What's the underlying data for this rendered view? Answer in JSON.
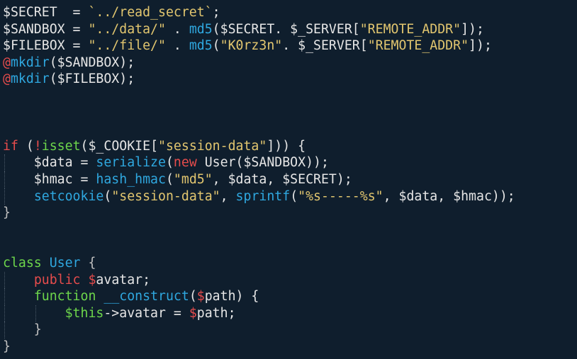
{
  "palette": {
    "background": "#0f1e2d",
    "default": "#e6e6e6",
    "variable": "#e6e6e6",
    "string": "#e2c66f",
    "function": "#2fa8e0",
    "keyword": "#e64c4c",
    "class": "#6dd64b",
    "this": "#6dd64b",
    "brace": "#bfbfbf"
  },
  "lines": [
    {
      "indent": 0,
      "tokens": [
        {
          "t": "$SECRET  = ",
          "c": "variable"
        },
        {
          "t": "`../read_secret`",
          "c": "string"
        },
        {
          "t": ";",
          "c": "default"
        }
      ]
    },
    {
      "indent": 0,
      "tokens": [
        {
          "t": "$SANDBOX = ",
          "c": "variable"
        },
        {
          "t": "\"../data/\"",
          "c": "string"
        },
        {
          "t": " . ",
          "c": "default"
        },
        {
          "t": "md5",
          "c": "function"
        },
        {
          "t": "($SECRET. $_SERVER[",
          "c": "default"
        },
        {
          "t": "\"REMOTE_ADDR\"",
          "c": "string"
        },
        {
          "t": "]);",
          "c": "default"
        }
      ]
    },
    {
      "indent": 0,
      "tokens": [
        {
          "t": "$FILEBOX = ",
          "c": "variable"
        },
        {
          "t": "\"../file/\"",
          "c": "string"
        },
        {
          "t": " . ",
          "c": "default"
        },
        {
          "t": "md5",
          "c": "function"
        },
        {
          "t": "(",
          "c": "default"
        },
        {
          "t": "\"K0rz3n\"",
          "c": "string"
        },
        {
          "t": ". $_SERVER[",
          "c": "default"
        },
        {
          "t": "\"REMOTE_ADDR\"",
          "c": "string"
        },
        {
          "t": "]);",
          "c": "default"
        }
      ]
    },
    {
      "indent": 0,
      "tokens": [
        {
          "t": "@",
          "c": "keyword"
        },
        {
          "t": "mkdir",
          "c": "function"
        },
        {
          "t": "($SANDBOX);",
          "c": "default"
        }
      ]
    },
    {
      "indent": 0,
      "tokens": [
        {
          "t": "@",
          "c": "keyword"
        },
        {
          "t": "mkdir",
          "c": "function"
        },
        {
          "t": "($FILEBOX);",
          "c": "default"
        }
      ]
    },
    {
      "indent": 0,
      "tokens": []
    },
    {
      "indent": 0,
      "tokens": []
    },
    {
      "indent": 0,
      "tokens": []
    },
    {
      "indent": 0,
      "tokens": [
        {
          "t": "if",
          "c": "keyword"
        },
        {
          "t": " (",
          "c": "default"
        },
        {
          "t": "!",
          "c": "keyword"
        },
        {
          "t": "isset",
          "c": "class"
        },
        {
          "t": "($_COOKIE[",
          "c": "default"
        },
        {
          "t": "\"session-data\"",
          "c": "string"
        },
        {
          "t": "])) {",
          "c": "default"
        }
      ]
    },
    {
      "indent": 1,
      "tokens": [
        {
          "t": "    $data = ",
          "c": "default"
        },
        {
          "t": "serialize",
          "c": "function"
        },
        {
          "t": "(",
          "c": "default"
        },
        {
          "t": "new",
          "c": "keyword"
        },
        {
          "t": " User($SANDBOX));",
          "c": "default"
        }
      ]
    },
    {
      "indent": 1,
      "tokens": [
        {
          "t": "    $hmac = ",
          "c": "default"
        },
        {
          "t": "hash_hmac",
          "c": "function"
        },
        {
          "t": "(",
          "c": "default"
        },
        {
          "t": "\"md5\"",
          "c": "string"
        },
        {
          "t": ", $data, $SECRET);",
          "c": "default"
        }
      ]
    },
    {
      "indent": 1,
      "tokens": [
        {
          "t": "    ",
          "c": "default"
        },
        {
          "t": "setcookie",
          "c": "function"
        },
        {
          "t": "(",
          "c": "default"
        },
        {
          "t": "\"session-data\"",
          "c": "string"
        },
        {
          "t": ", ",
          "c": "default"
        },
        {
          "t": "sprintf",
          "c": "function"
        },
        {
          "t": "(",
          "c": "default"
        },
        {
          "t": "\"%s-----%s\"",
          "c": "string"
        },
        {
          "t": ", $data, $hmac));",
          "c": "default"
        }
      ]
    },
    {
      "indent": 0,
      "tokens": [
        {
          "t": "}",
          "c": "brace"
        }
      ]
    },
    {
      "indent": 0,
      "tokens": []
    },
    {
      "indent": 0,
      "tokens": []
    },
    {
      "indent": 0,
      "tokens": [
        {
          "t": "class",
          "c": "class"
        },
        {
          "t": " ",
          "c": "default"
        },
        {
          "t": "User",
          "c": "function"
        },
        {
          "t": " {",
          "c": "brace"
        }
      ]
    },
    {
      "indent": 1,
      "tokens": [
        {
          "t": "    ",
          "c": "default"
        },
        {
          "t": "public",
          "c": "keyword"
        },
        {
          "t": " ",
          "c": "default"
        },
        {
          "t": "$",
          "c": "keyword"
        },
        {
          "t": "avatar;",
          "c": "default"
        }
      ]
    },
    {
      "indent": 1,
      "tokens": [
        {
          "t": "    ",
          "c": "default"
        },
        {
          "t": "function",
          "c": "class"
        },
        {
          "t": " ",
          "c": "default"
        },
        {
          "t": "__construct",
          "c": "function"
        },
        {
          "t": "(",
          "c": "default"
        },
        {
          "t": "$",
          "c": "keyword"
        },
        {
          "t": "path) {",
          "c": "default"
        }
      ]
    },
    {
      "indent": 2,
      "tokens": [
        {
          "t": "        ",
          "c": "default"
        },
        {
          "t": "$this",
          "c": "this"
        },
        {
          "t": "->avatar = ",
          "c": "default"
        },
        {
          "t": "$",
          "c": "keyword"
        },
        {
          "t": "path;",
          "c": "default"
        }
      ]
    },
    {
      "indent": 1,
      "tokens": [
        {
          "t": "    }",
          "c": "brace"
        }
      ]
    },
    {
      "indent": 0,
      "tokens": [
        {
          "t": "}",
          "c": "brace"
        }
      ]
    }
  ]
}
